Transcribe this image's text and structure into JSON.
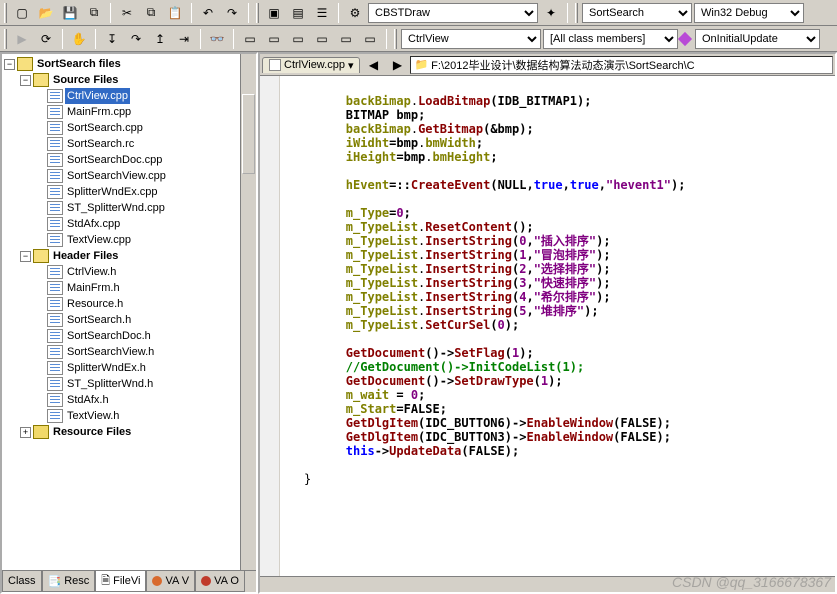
{
  "toolbars": {
    "row1": {
      "combo_class": "CBSTDraw",
      "combo_proj": "SortSearch",
      "combo_cfg": "Win32 Debug"
    },
    "row2": {
      "combo_view": "CtrlView",
      "combo_members": "[All class members]",
      "combo_fn": "OnInitialUpdate"
    }
  },
  "doc": {
    "active_tab": "CtrlView.cpp",
    "path": "F:\\2012毕业设计\\数据结构算法动态演示\\SortSearch\\C"
  },
  "tree": {
    "root": "SortSearch files",
    "groups": [
      {
        "name": "Source Files",
        "expanded": true,
        "selected": "CtrlView.cpp",
        "items": [
          "CtrlView.cpp",
          "MainFrm.cpp",
          "SortSearch.cpp",
          "SortSearch.rc",
          "SortSearchDoc.cpp",
          "SortSearchView.cpp",
          "SplitterWndEx.cpp",
          "ST_SplitterWnd.cpp",
          "StdAfx.cpp",
          "TextView.cpp"
        ]
      },
      {
        "name": "Header Files",
        "expanded": true,
        "items": [
          "CtrlView.h",
          "MainFrm.h",
          "Resource.h",
          "SortSearch.h",
          "SortSearchDoc.h",
          "SortSearchView.h",
          "SplitterWndEx.h",
          "ST_SplitterWnd.h",
          "StdAfx.h",
          "TextView.h"
        ]
      },
      {
        "name": "Resource Files",
        "expanded": false,
        "items": []
      }
    ]
  },
  "tabs": {
    "t0": "Class",
    "t1": "Resc",
    "t2": "FileVi",
    "t3": "VA V",
    "t4": "VA O"
  },
  "code": {
    "lines": [
      [
        [
          "mem",
          "backBimap"
        ],
        [
          ".",
          ""
        ],
        [
          "fn",
          "LoadBitmap"
        ],
        [
          "op",
          "("
        ],
        [
          "id",
          "IDB_BITMAP1"
        ],
        [
          "op",
          ");"
        ]
      ],
      [
        [
          "id",
          "BITMAP"
        ],
        [
          " ",
          ""
        ],
        [
          "id",
          "bmp"
        ],
        [
          "op",
          ";"
        ]
      ],
      [
        [
          "mem",
          "backBimap"
        ],
        [
          ".",
          ""
        ],
        [
          "fn",
          "GetBitmap"
        ],
        [
          "op",
          "(&"
        ],
        [
          "id",
          "bmp"
        ],
        [
          "op",
          ");"
        ]
      ],
      [
        [
          "mem",
          "iWidht"
        ],
        [
          "op",
          "="
        ],
        [
          "id",
          "bmp"
        ],
        [
          ".",
          ""
        ],
        [
          "mem",
          "bmWidth"
        ],
        [
          "op",
          ";"
        ]
      ],
      [
        [
          "mem",
          "iHeight"
        ],
        [
          "op",
          "="
        ],
        [
          "id",
          "bmp"
        ],
        [
          ".",
          ""
        ],
        [
          "mem",
          "bmHeight"
        ],
        [
          "op",
          ";"
        ]
      ],
      [],
      [
        [
          "mem",
          "hEvent"
        ],
        [
          "op",
          "=::"
        ],
        [
          "fn",
          "CreateEvent"
        ],
        [
          "op",
          "("
        ],
        [
          "id",
          "NULL"
        ],
        [
          "op",
          ","
        ],
        [
          "kw",
          "true"
        ],
        [
          "op",
          ","
        ],
        [
          "kw",
          "true"
        ],
        [
          "op",
          ","
        ],
        [
          "str",
          "\"hevent1\""
        ],
        [
          "op",
          ");"
        ]
      ],
      [],
      [
        [
          "mem",
          "m_Type"
        ],
        [
          "op",
          "="
        ],
        [
          "num",
          "0"
        ],
        [
          "op",
          ";"
        ]
      ],
      [
        [
          "mem",
          "m_TypeList"
        ],
        [
          ".",
          ""
        ],
        [
          "fn",
          "ResetContent"
        ],
        [
          "op",
          "();"
        ]
      ],
      [
        [
          "mem",
          "m_TypeList"
        ],
        [
          ".",
          ""
        ],
        [
          "fn",
          "InsertString"
        ],
        [
          "op",
          "("
        ],
        [
          "num",
          "0"
        ],
        [
          "op",
          ","
        ],
        [
          "str",
          "\"插入排序\""
        ],
        [
          "op",
          ");"
        ]
      ],
      [
        [
          "mem",
          "m_TypeList"
        ],
        [
          ".",
          ""
        ],
        [
          "fn",
          "InsertString"
        ],
        [
          "op",
          "("
        ],
        [
          "num",
          "1"
        ],
        [
          "op",
          ","
        ],
        [
          "str",
          "\"冒泡排序\""
        ],
        [
          "op",
          ");"
        ]
      ],
      [
        [
          "mem",
          "m_TypeList"
        ],
        [
          ".",
          ""
        ],
        [
          "fn",
          "InsertString"
        ],
        [
          "op",
          "("
        ],
        [
          "num",
          "2"
        ],
        [
          "op",
          ","
        ],
        [
          "str",
          "\"选择排序\""
        ],
        [
          "op",
          ");"
        ]
      ],
      [
        [
          "mem",
          "m_TypeList"
        ],
        [
          ".",
          ""
        ],
        [
          "fn",
          "InsertString"
        ],
        [
          "op",
          "("
        ],
        [
          "num",
          "3"
        ],
        [
          "op",
          ","
        ],
        [
          "str",
          "\"快速排序\""
        ],
        [
          "op",
          ");"
        ]
      ],
      [
        [
          "mem",
          "m_TypeList"
        ],
        [
          ".",
          ""
        ],
        [
          "fn",
          "InsertString"
        ],
        [
          "op",
          "("
        ],
        [
          "num",
          "4"
        ],
        [
          "op",
          ","
        ],
        [
          "str",
          "\"希尔排序\""
        ],
        [
          "op",
          ");"
        ]
      ],
      [
        [
          "mem",
          "m_TypeList"
        ],
        [
          ".",
          ""
        ],
        [
          "fn",
          "InsertString"
        ],
        [
          "op",
          "("
        ],
        [
          "num",
          "5"
        ],
        [
          "op",
          ","
        ],
        [
          "str",
          "\"堆排序\""
        ],
        [
          "op",
          ");"
        ]
      ],
      [
        [
          "mem",
          "m_TypeList"
        ],
        [
          ".",
          ""
        ],
        [
          "fn",
          "SetCurSel"
        ],
        [
          "op",
          "("
        ],
        [
          "num",
          "0"
        ],
        [
          "op",
          ");"
        ]
      ],
      [],
      [
        [
          "fn",
          "GetDocument"
        ],
        [
          "op",
          "()->"
        ],
        [
          "fn",
          "SetFlag"
        ],
        [
          "op",
          "("
        ],
        [
          "num",
          "1"
        ],
        [
          "op",
          ");"
        ]
      ],
      [
        [
          "cmt",
          "//GetDocument()->InitCodeList(1);"
        ]
      ],
      [
        [
          "fn",
          "GetDocument"
        ],
        [
          "op",
          "()->"
        ],
        [
          "fn",
          "SetDrawType"
        ],
        [
          "op",
          "("
        ],
        [
          "num",
          "1"
        ],
        [
          "op",
          ");"
        ]
      ],
      [
        [
          "mem",
          "m_wait"
        ],
        [
          "op",
          " = "
        ],
        [
          "num",
          "0"
        ],
        [
          "op",
          ";"
        ]
      ],
      [
        [
          "mem",
          "m_Start"
        ],
        [
          "op",
          "="
        ],
        [
          "id",
          "FALSE"
        ],
        [
          "op",
          ";"
        ]
      ],
      [
        [
          "fn",
          "GetDlgItem"
        ],
        [
          "op",
          "("
        ],
        [
          "id",
          "IDC_BUTTON6"
        ],
        [
          "op",
          ")->"
        ],
        [
          "fn",
          "EnableWindow"
        ],
        [
          "op",
          "("
        ],
        [
          "id",
          "FALSE"
        ],
        [
          "op",
          ");"
        ]
      ],
      [
        [
          "fn",
          "GetDlgItem"
        ],
        [
          "op",
          "("
        ],
        [
          "id",
          "IDC_BUTTON3"
        ],
        [
          "op",
          ")->"
        ],
        [
          "fn",
          "EnableWindow"
        ],
        [
          "op",
          "("
        ],
        [
          "id",
          "FALSE"
        ],
        [
          "op",
          ");"
        ]
      ],
      [
        [
          "kw",
          "this"
        ],
        [
          "op",
          "->"
        ],
        [
          "fn",
          "UpdateData"
        ],
        [
          "op",
          "("
        ],
        [
          "id",
          "FALSE"
        ],
        [
          "op",
          ");"
        ]
      ]
    ]
  },
  "watermark": "CSDN @qq_3166678367"
}
